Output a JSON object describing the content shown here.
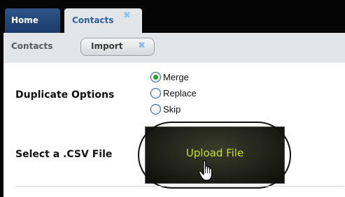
{
  "tabs": {
    "home_label": "Home",
    "contacts_label": "Contacts",
    "close_glyph": "✖"
  },
  "subnav": {
    "contacts_label": "Contacts",
    "import_label": "Import",
    "close_glyph": "✖"
  },
  "form": {
    "duplicate_label": "Duplicate Options",
    "options": [
      {
        "label": "Merge",
        "checked": true
      },
      {
        "label": "Replace",
        "checked": false
      },
      {
        "label": "Skip",
        "checked": false
      }
    ],
    "csv_label": "Select a .CSV File",
    "upload_label": "Upload File"
  },
  "colors": {
    "topbar": "#050505",
    "home_tab": "#2d5488",
    "contacts_tab_text": "#2b5f98",
    "upload_text": "#c8dc3c",
    "radio_checked": "#22aa22"
  },
  "icons": {
    "tab_close": "close-icon",
    "cursor": "hand-pointer-icon"
  }
}
